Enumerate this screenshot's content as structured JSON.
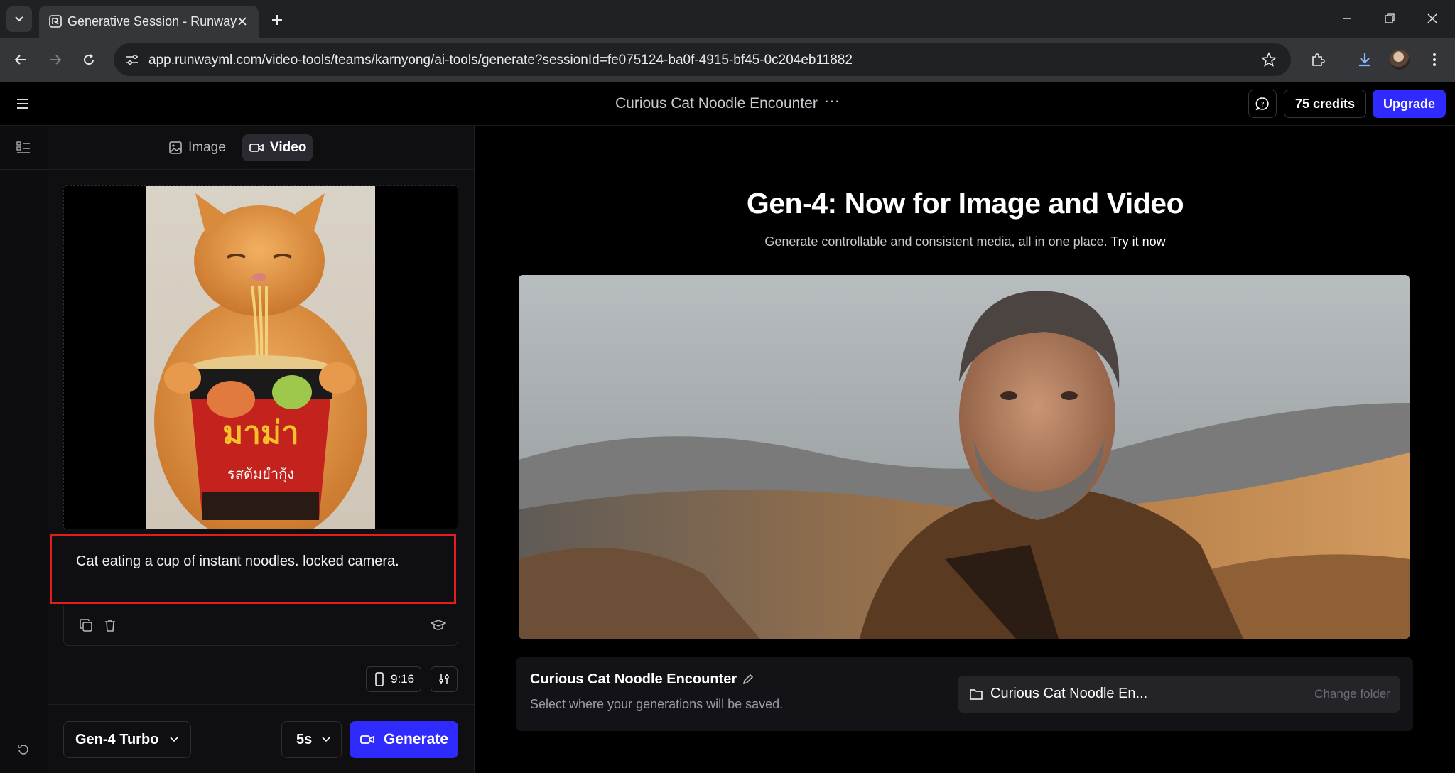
{
  "browser": {
    "tab_title": "Generative Session - Runway",
    "url": "app.runwayml.com/video-tools/teams/karnyong/ai-tools/generate?sessionId=fe075124-ba0f-4915-bf45-0c204eb11882"
  },
  "header": {
    "session_title": "Curious Cat Noodle Encounter",
    "more_label": "···",
    "credits_label": "75 credits",
    "upgrade_label": "Upgrade"
  },
  "mode_tabs": {
    "image_label": "Image",
    "video_label": "Video",
    "active": "Video"
  },
  "prompt": {
    "value": "Cat eating a cup of instant noodles. locked camera.",
    "highlight_color": "#e11d1d"
  },
  "controls": {
    "aspect_ratio": "9:16",
    "model": "Gen-4 Turbo",
    "duration": "5s",
    "generate_label": "Generate"
  },
  "promo": {
    "title": "Gen-4: Now for Image and Video",
    "subtitle": "Generate controllable and consistent media, all in one place.",
    "link_label": "Try it now"
  },
  "session_card": {
    "title": "Curious Cat Noodle Encounter",
    "subtitle": "Select where your generations will be saved.",
    "folder_name": "Curious Cat Noodle En...",
    "change_folder_label": "Change folder"
  },
  "colors": {
    "accent": "#2f2bff",
    "background": "#000000",
    "panel": "#0f0f12"
  }
}
